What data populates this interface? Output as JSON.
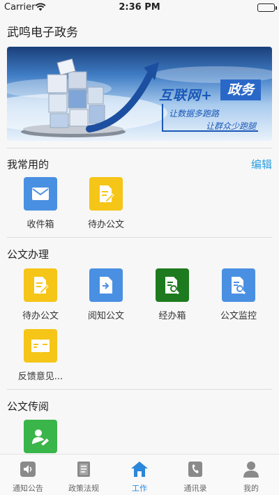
{
  "status_bar": {
    "carrier": "Carrier",
    "time": "2:36 PM"
  },
  "app_title": "武鸣电子政务",
  "banner": {
    "title_a": "互联网+",
    "title_b": "政务",
    "subtitle_1": "让数据多跑路",
    "subtitle_2": "让群众少跑腿"
  },
  "favorites": {
    "title": "我常用的",
    "edit_label": "编辑",
    "items": [
      {
        "label": "收件箱",
        "icon": "mail-icon",
        "color": "#4a90e2"
      },
      {
        "label": "待办公文",
        "icon": "edit-document-icon",
        "color": "#f5c518"
      }
    ]
  },
  "document_processing": {
    "title": "公文办理",
    "items": [
      {
        "label": "待办公文",
        "icon": "edit-document-icon",
        "color": "#f5c518"
      },
      {
        "label": "阅知公文",
        "icon": "forward-document-icon",
        "color": "#4a90e2"
      },
      {
        "label": "经办箱",
        "icon": "search-document-icon",
        "color": "#1e7a1e"
      },
      {
        "label": "公文监控",
        "icon": "monitor-document-icon",
        "color": "#4a90e2"
      },
      {
        "label": "反馈意见...",
        "icon": "feedback-icon",
        "color": "#f5c518"
      }
    ]
  },
  "document_circulation": {
    "title": "公文传阅",
    "items": [
      {
        "label": "",
        "icon": "circulation-user-icon",
        "color": "#3ab54a"
      }
    ]
  },
  "tabbar": {
    "active_color": "#2b87d9",
    "items": [
      {
        "label": "通知公告",
        "icon": "speaker-icon"
      },
      {
        "label": "政策法规",
        "icon": "book-icon"
      },
      {
        "label": "工作",
        "icon": "home-icon",
        "active": true
      },
      {
        "label": "通讯录",
        "icon": "phone-icon"
      },
      {
        "label": "我的",
        "icon": "user-icon"
      }
    ]
  }
}
